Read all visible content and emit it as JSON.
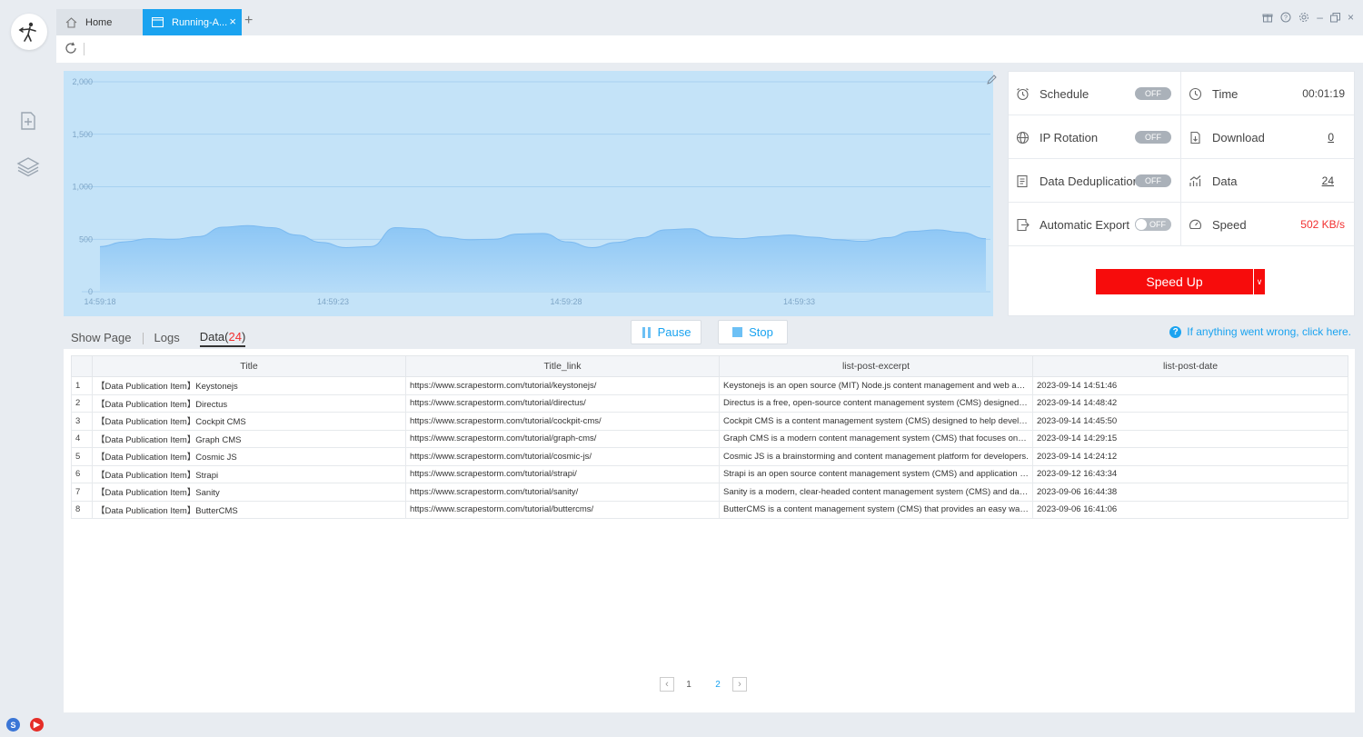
{
  "tabs": {
    "home_label": "Home",
    "active_label": "Running-A...",
    "close": "×",
    "add": "+"
  },
  "window_controls": {
    "minimize": "–",
    "close": "×"
  },
  "chart_data": {
    "type": "area",
    "yticks": [
      "2,000",
      "1,500",
      "1,000",
      "500",
      "0"
    ],
    "ylim": [
      0,
      2000
    ],
    "xticks": [
      "14:59:18",
      "14:59:23",
      "14:59:28",
      "14:59:33"
    ],
    "values": [
      430,
      475,
      505,
      500,
      525,
      615,
      630,
      610,
      540,
      470,
      420,
      430,
      610,
      600,
      520,
      495,
      500,
      550,
      555,
      475,
      420,
      470,
      515,
      590,
      600,
      520,
      505,
      525,
      540,
      520,
      495,
      480,
      515,
      575,
      590,
      565,
      505
    ],
    "colors": {
      "fill": "#a8d4f5",
      "line": "#7cbaf0",
      "bg": "#c4e3f8"
    }
  },
  "stats": {
    "schedule_label": "Schedule",
    "schedule_state": "OFF",
    "time_label": "Time",
    "time_value": "00:01:19",
    "ip_label": "IP Rotation",
    "ip_state": "OFF",
    "download_label": "Download",
    "download_value": "0",
    "dedup_label": "Data Deduplication",
    "dedup_state": "OFF",
    "data_label": "Data",
    "data_value": "24",
    "export_label": "Automatic Export",
    "export_state": "OFF",
    "speed_label": "Speed",
    "speed_value": "502 KB/s",
    "speed_up": "Speed Up",
    "speed_up_drop": "∨"
  },
  "subtabs": {
    "show_page": "Show Page",
    "logs": "Logs",
    "data": "Data(",
    "data_count": "24",
    "data_close": ")"
  },
  "controls": {
    "pause": "Pause",
    "stop": "Stop",
    "help": "If anything went wrong, click here.",
    "help_icon": "?"
  },
  "table": {
    "columns": [
      "Title",
      "Title_link",
      "list-post-excerpt",
      "list-post-date"
    ],
    "rows": [
      [
        "1",
        "【Data Publication Item】Keystonejs",
        "https://www.scrapestorm.com/tutorial/keystonejs/",
        "Keystonejs is an open source (MIT) Node.js content management and web application framework.",
        "2023-09-14 14:51:46"
      ],
      [
        "2",
        "【Data Publication Item】Directus",
        "https://www.scrapestorm.com/tutorial/directus/",
        "Directus is a free, open-source content management system (CMS) designed to manage content.",
        "2023-09-14 14:48:42"
      ],
      [
        "3",
        "【Data Publication Item】Cockpit CMS",
        "https://www.scrapestorm.com/tutorial/cockpit-cms/",
        "Cockpit CMS is a content management system (CMS) designed to help developers.",
        "2023-09-14 14:45:50"
      ],
      [
        "4",
        "【Data Publication Item】Graph CMS",
        "https://www.scrapestorm.com/tutorial/graph-cms/",
        "Graph CMS is a modern content management system (CMS) that focuses on providing.",
        "2023-09-14 14:29:15"
      ],
      [
        "5",
        "【Data Publication Item】Cosmic JS",
        "https://www.scrapestorm.com/tutorial/cosmic-js/",
        "Cosmic JS is a brainstorming and content management platform for developers.",
        "2023-09-14 14:24:12"
      ],
      [
        "6",
        "【Data Publication Item】Strapi",
        "https://www.scrapestorm.com/tutorial/strapi/",
        "Strapi is an open source content management system (CMS) and application builder.",
        "2023-09-12 16:43:34"
      ],
      [
        "7",
        "【Data Publication Item】Sanity",
        "https://www.scrapestorm.com/tutorial/sanity/",
        "Sanity is a modern, clear-headed content management system (CMS) and data platform.",
        "2023-09-06 16:44:38"
      ],
      [
        "8",
        "【Data Publication Item】ButterCMS",
        "https://www.scrapestorm.com/tutorial/buttercms/",
        "ButterCMS is a content management system (CMS) that provides an easy way to manage.",
        "2023-09-06 16:41:06"
      ]
    ]
  },
  "pager": {
    "prev": "‹",
    "next": "›",
    "pages": [
      "1",
      "2"
    ],
    "current": "2"
  }
}
